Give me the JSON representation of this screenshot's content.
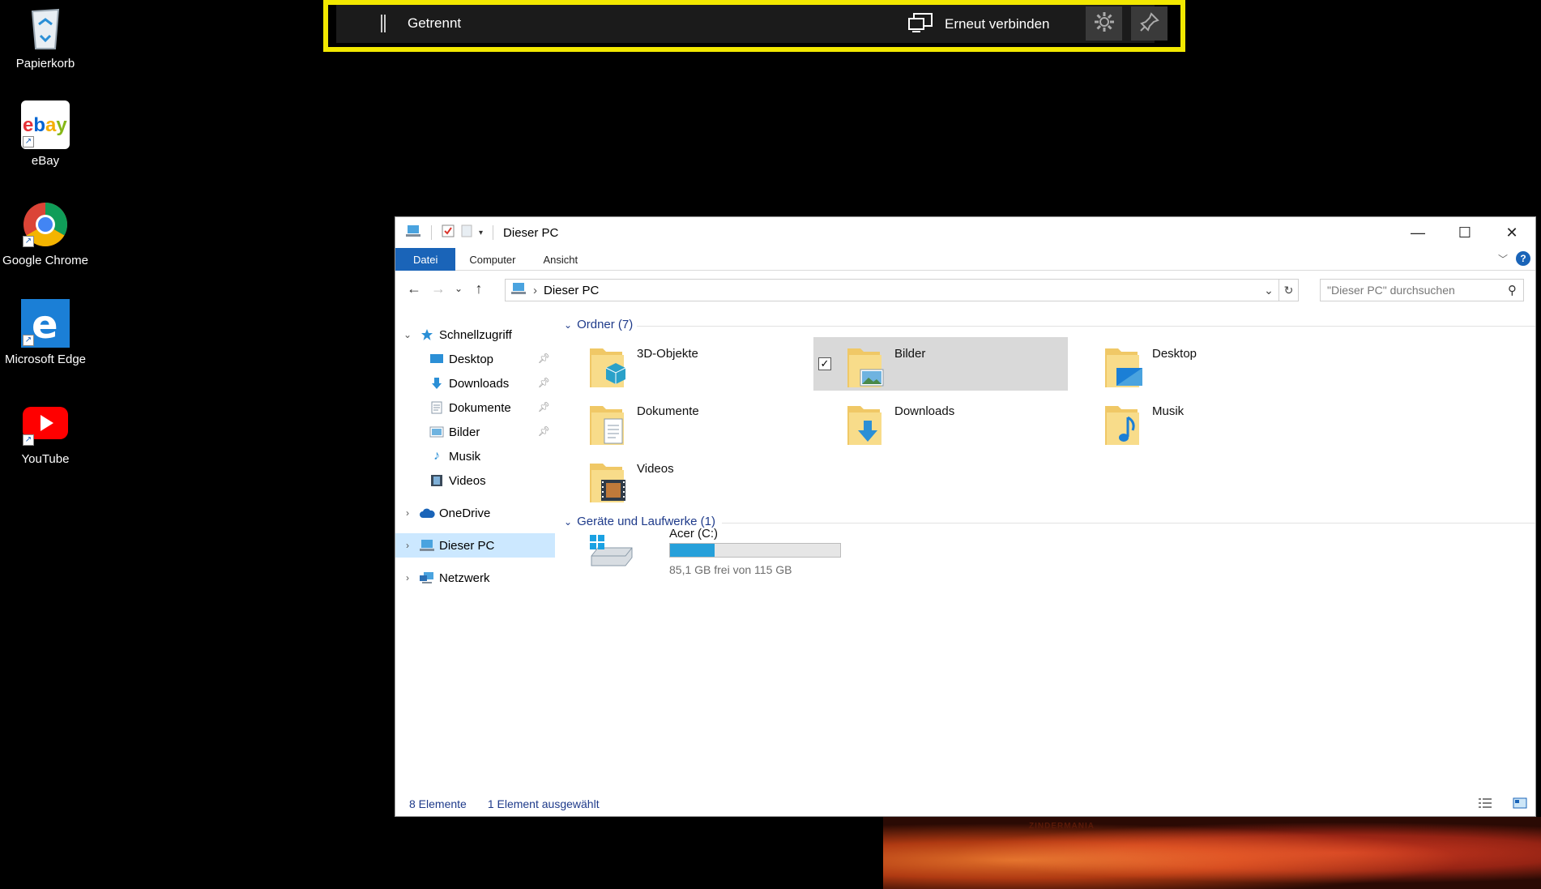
{
  "desktop": {
    "icons": [
      {
        "label": "Papierkorb",
        "icon": "recycle-bin-icon"
      },
      {
        "label": "eBay",
        "icon": "ebay-icon"
      },
      {
        "label": "Google Chrome",
        "icon": "chrome-icon"
      },
      {
        "label": "Microsoft Edge",
        "icon": "edge-icon"
      },
      {
        "label": "YouTube",
        "icon": "youtube-icon"
      }
    ],
    "wallpaper_text": "ZINDERMANIA"
  },
  "remote_bar": {
    "status": "Getrennt",
    "reconnect_label": "Erneut verbinden",
    "accent": "#f2e800"
  },
  "explorer": {
    "title": "Dieser PC",
    "ribbon_tabs": [
      "Datei",
      "Computer",
      "Ansicht"
    ],
    "address": "Dieser PC",
    "search_placeholder": "\"Dieser PC\" durchsuchen",
    "nav": {
      "quick_access": "Schnellzugriff",
      "quick_items": [
        "Desktop",
        "Downloads",
        "Dokumente",
        "Bilder",
        "Musik",
        "Videos"
      ],
      "onedrive": "OneDrive",
      "this_pc": "Dieser PC",
      "network": "Netzwerk"
    },
    "groups": {
      "folders": "Ordner (7)",
      "devices": "Geräte und Laufwerke (1)"
    },
    "folders": [
      "3D-Objekte",
      "Bilder",
      "Desktop",
      "Dokumente",
      "Downloads",
      "Musik",
      "Videos"
    ],
    "selected_folder": "Bilder",
    "drive": {
      "name": "Acer (C:)",
      "free_text": "85,1 GB frei von 115 GB",
      "used_fraction": 0.26
    },
    "status": {
      "count": "8 Elemente",
      "selection": "1 Element ausgewählt"
    },
    "accent": "#1a64b8"
  }
}
